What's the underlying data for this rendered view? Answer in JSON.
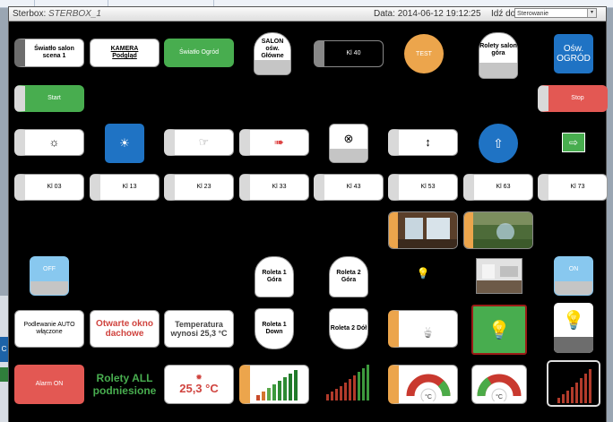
{
  "header": {
    "app_label": "Sterbox:",
    "app_name": "STERBOX_1",
    "date_label": "Data:",
    "date_value": "2014-06-12 19:12:25",
    "goto_label": "Idź do:",
    "goto_value": "Sterowanie"
  },
  "colors": {
    "accent_orange": "#eca54c",
    "green": "#48ad4f",
    "red": "#e35853",
    "blue": "#1f73c4"
  },
  "row1": {
    "b1": "Światło salon scena 1",
    "b2a": "KAMERA",
    "b2b": "Podgląd",
    "b3": "Światło Ogród",
    "b4": "SALON ośw. Główne",
    "b5": "Kl 40",
    "b6": "TEST",
    "b7": "Rolety salon góra",
    "b8": "Ośw. OGRÓD"
  },
  "row2": {
    "start": "Start",
    "stop": "Stop"
  },
  "row3": {
    "icons": [
      "sun-outline-icon",
      "sun-icon",
      "hand-pointer-icon",
      "arrow-right-icon",
      "circle-x-icon",
      "updown-arrow-icon",
      "arrow-up-icon",
      "arrow-right-box-icon"
    ],
    "glyphs": [
      "☼",
      "☀",
      "☞",
      "➠",
      "⊗",
      "↕",
      "⇧",
      "⇨"
    ]
  },
  "row4": {
    "labels": [
      "Kl 03",
      "Kl 13",
      "Kl 23",
      "Kl 33",
      "Kl 43",
      "Kl 53",
      "Kl 63",
      "Kl 73"
    ]
  },
  "row6": {
    "off": "OFF",
    "roleta1_gora": "Roleta 1 Góra",
    "roleta2_gora": "Roleta 2 Góra",
    "bulb_glyph": "💡",
    "on": "ON"
  },
  "row7": {
    "podlewanie": "Podlewanie AUTO włączone",
    "okno": "Otwarte okno dachowe",
    "temp_text": "Temperatura wynosi 25,3 °C",
    "roleta1_down": "Roleta 1 Down",
    "roleta2_dol": "Roleta 2 Dół",
    "bulb": "💡"
  },
  "row8": {
    "alarm": "Alarm ON",
    "rolety_all": "Rolety ALL podniesione",
    "temp_value": "25,3 °C",
    "gauge_unit": "°C"
  }
}
